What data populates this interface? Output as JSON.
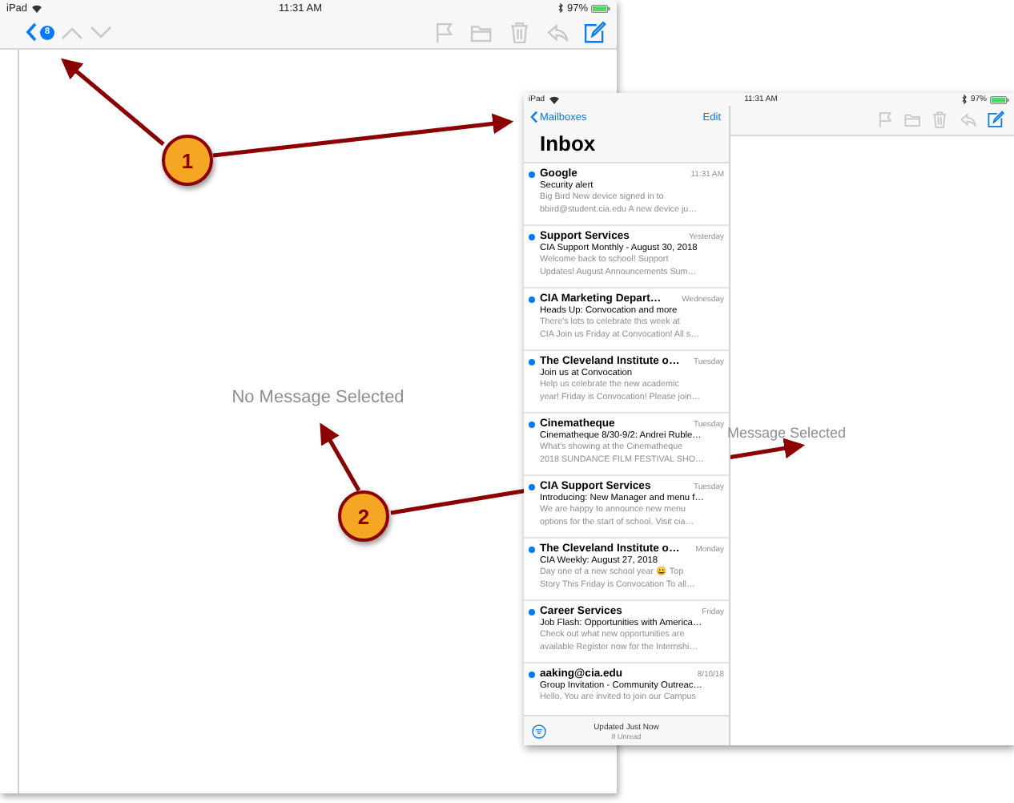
{
  "back_screen": {
    "status_bar": {
      "carrier": "iPad",
      "time": "11:31 AM",
      "battery": "97%"
    },
    "toolbar": {
      "badge": "8"
    },
    "empty_message": "No Message Selected"
  },
  "front_screen": {
    "status_bar": {
      "carrier": "iPad",
      "time": "11:31 AM",
      "battery": "97%"
    },
    "nav": {
      "back": "Mailboxes",
      "action": "Edit"
    },
    "title": "Inbox",
    "messages": [
      {
        "sender": "Google",
        "time": "11:31 AM",
        "subject": "Security alert",
        "preview_lines": [
          "Big Bird New device signed in to",
          "bbird@student.cia.edu A new device ju…"
        ],
        "unread": true
      },
      {
        "sender": "Support Services",
        "time": "Yesterday",
        "subject": "CIA Support Monthly - August 30, 2018",
        "preview_lines": [
          "Welcome back to school! Support",
          "Updates! August Announcements Sum…"
        ],
        "unread": true
      },
      {
        "sender": "CIA Marketing Depart…",
        "time": "Wednesday",
        "subject": "Heads Up: Convocation and more",
        "preview_lines": [
          "There's lots to celebrate this week at",
          "CIA Join us Friday at Convocation! All s…"
        ],
        "unread": true
      },
      {
        "sender": "The Cleveland Institute o…",
        "time": "Tuesday",
        "subject": "Join us at Convocation",
        "preview_lines": [
          "Help us celebrate the new academic",
          "year! Friday is Convocation! Please join…"
        ],
        "unread": true
      },
      {
        "sender": "Cinematheque",
        "time": "Tuesday",
        "subject": "Cinematheque 8/30-9/2: Andrei Ruble…",
        "preview_lines": [
          "What's showing at the Cinematheque",
          "2018 SUNDANCE FILM FESTIVAL SHO…"
        ],
        "unread": true
      },
      {
        "sender": "CIA Support Services",
        "time": "Tuesday",
        "subject": "Introducing: New Manager and menu f…",
        "preview_lines": [
          "We are happy to announce new menu",
          "options for the start of school. Visit cia…"
        ],
        "unread": true
      },
      {
        "sender": "The Cleveland Institute o…",
        "time": "Monday",
        "subject": "CIA Weekly: August 27, 2018",
        "preview_lines": [
          "Day one of a new school year 😀 Top",
          "Story This Friday is Convocation To all…"
        ],
        "unread": true
      },
      {
        "sender": "Career Services",
        "time": "Friday",
        "subject": "Job Flash: Opportunities with America…",
        "preview_lines": [
          "Check out what new opportunities are",
          "available Register now for the Internshi…"
        ],
        "unread": true
      },
      {
        "sender": "aaking@cia.edu",
        "time": "8/10/18",
        "subject": "Group Invitation - Community Outreac…",
        "preview_lines": [
          "Hello, You are invited to join our Campus"
        ],
        "unread": true
      }
    ],
    "footer": {
      "status": "Updated Just Now",
      "count": "8 Unread"
    },
    "empty_message": "Message Selected"
  },
  "callouts": [
    {
      "number": "1"
    },
    {
      "number": "2"
    }
  ]
}
